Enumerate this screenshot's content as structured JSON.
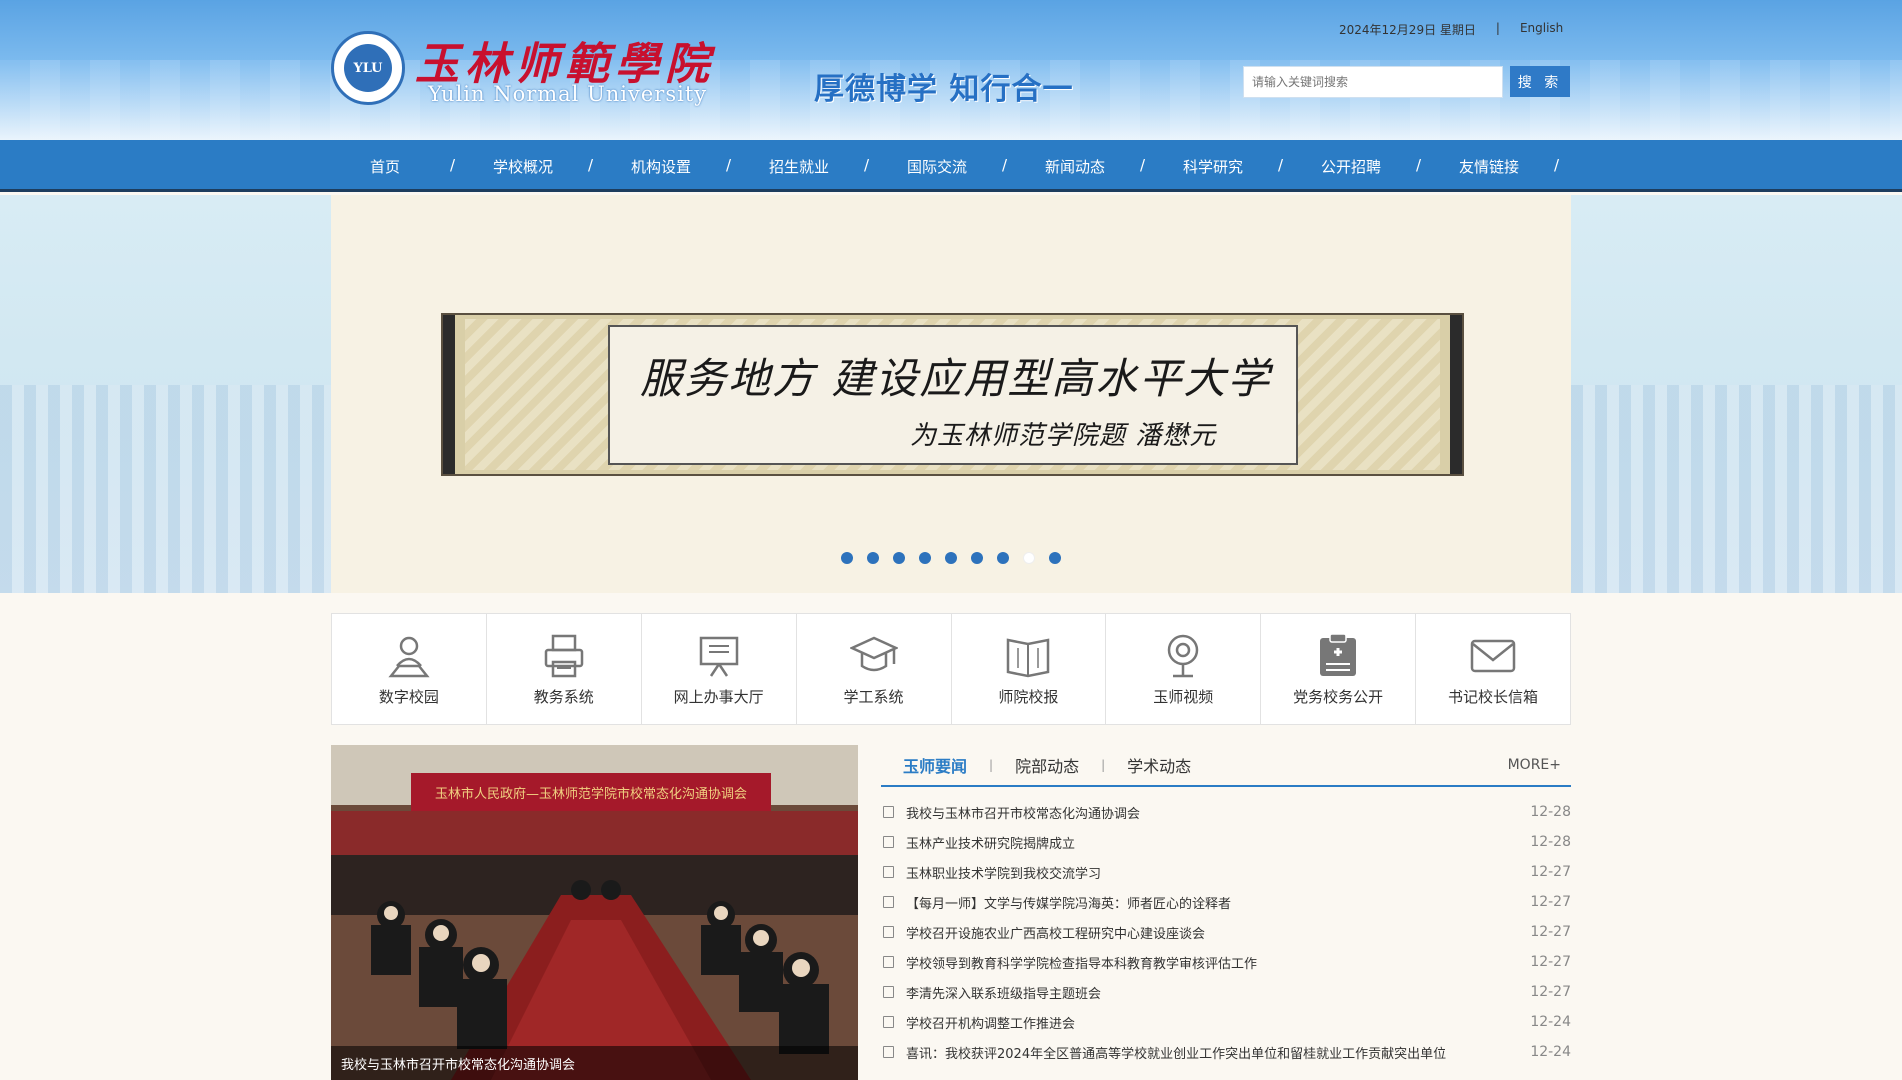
{
  "header": {
    "school_name_cn": "玉林师範學院",
    "school_name_en": "Yulin Normal University",
    "logo_text": "YLU",
    "motto": "厚德博学   知行合一",
    "date": "2024年12月29日 星期日",
    "separator": "|",
    "english_link": "English",
    "search_placeholder": "请输入关键词搜索",
    "search_button": "搜 索"
  },
  "nav": {
    "items": [
      {
        "label": "首页"
      },
      {
        "label": "学校概况"
      },
      {
        "label": "机构设置"
      },
      {
        "label": "招生就业"
      },
      {
        "label": "国际交流"
      },
      {
        "label": "新闻动态"
      },
      {
        "label": "科学研究"
      },
      {
        "label": "公开招聘"
      },
      {
        "label": "友情链接"
      }
    ],
    "slash": "/"
  },
  "banner": {
    "calligraphy_main": "服务地方 建设应用型高水平大学",
    "calligraphy_sub": "为玉林师范学院题 潘懋元",
    "active_dot": 7,
    "dot_count": 9
  },
  "quick_links": [
    {
      "label": "数字校园",
      "icon": "person-pin-icon"
    },
    {
      "label": "教务系统",
      "icon": "printer-icon"
    },
    {
      "label": "网上办事大厅",
      "icon": "presentation-board-icon"
    },
    {
      "label": "学工系统",
      "icon": "graduation-cap-icon"
    },
    {
      "label": "师院校报",
      "icon": "book-icon"
    },
    {
      "label": "玉师视频",
      "icon": "webcam-icon"
    },
    {
      "label": "党务校务公开",
      "icon": "clipboard-icon"
    },
    {
      "label": "书记校长信箱",
      "icon": "envelope-icon"
    }
  ],
  "photo": {
    "banner_text": "玉林市人民政府—玉林师范学院市校常态化沟通协调会",
    "caption": "我校与玉林市召开市校常态化沟通协调会"
  },
  "news": {
    "tabs": [
      {
        "label": "玉师要闻"
      },
      {
        "label": "院部动态"
      },
      {
        "label": "学术动态"
      }
    ],
    "tab_sep": "|",
    "more": "MORE+",
    "items": [
      {
        "title": "我校与玉林市召开市校常态化沟通协调会",
        "date": "12-28"
      },
      {
        "title": "玉林产业技术研究院揭牌成立",
        "date": "12-28"
      },
      {
        "title": "玉林职业技术学院到我校交流学习",
        "date": "12-27"
      },
      {
        "title": "【每月一师】文学与传媒学院冯海英：师者匠心的诠释者",
        "date": "12-27"
      },
      {
        "title": "学校召开设施农业广西高校工程研究中心建设座谈会",
        "date": "12-27"
      },
      {
        "title": "学校领导到教育科学学院检查指导本科教育教学审核评估工作",
        "date": "12-27"
      },
      {
        "title": "李清先深入联系班级指导主题班会",
        "date": "12-27"
      },
      {
        "title": "学校召开机构调整工作推进会",
        "date": "12-24"
      },
      {
        "title": "喜讯：我校获评2024年全区普通高等学校就业创业工作突出单位和留桂就业工作贡献突出单位",
        "date": "12-24"
      }
    ]
  },
  "colors": {
    "primary_blue": "#2b7cc5",
    "header_light": "#b6d9f6",
    "red_title": "#c8102e"
  }
}
